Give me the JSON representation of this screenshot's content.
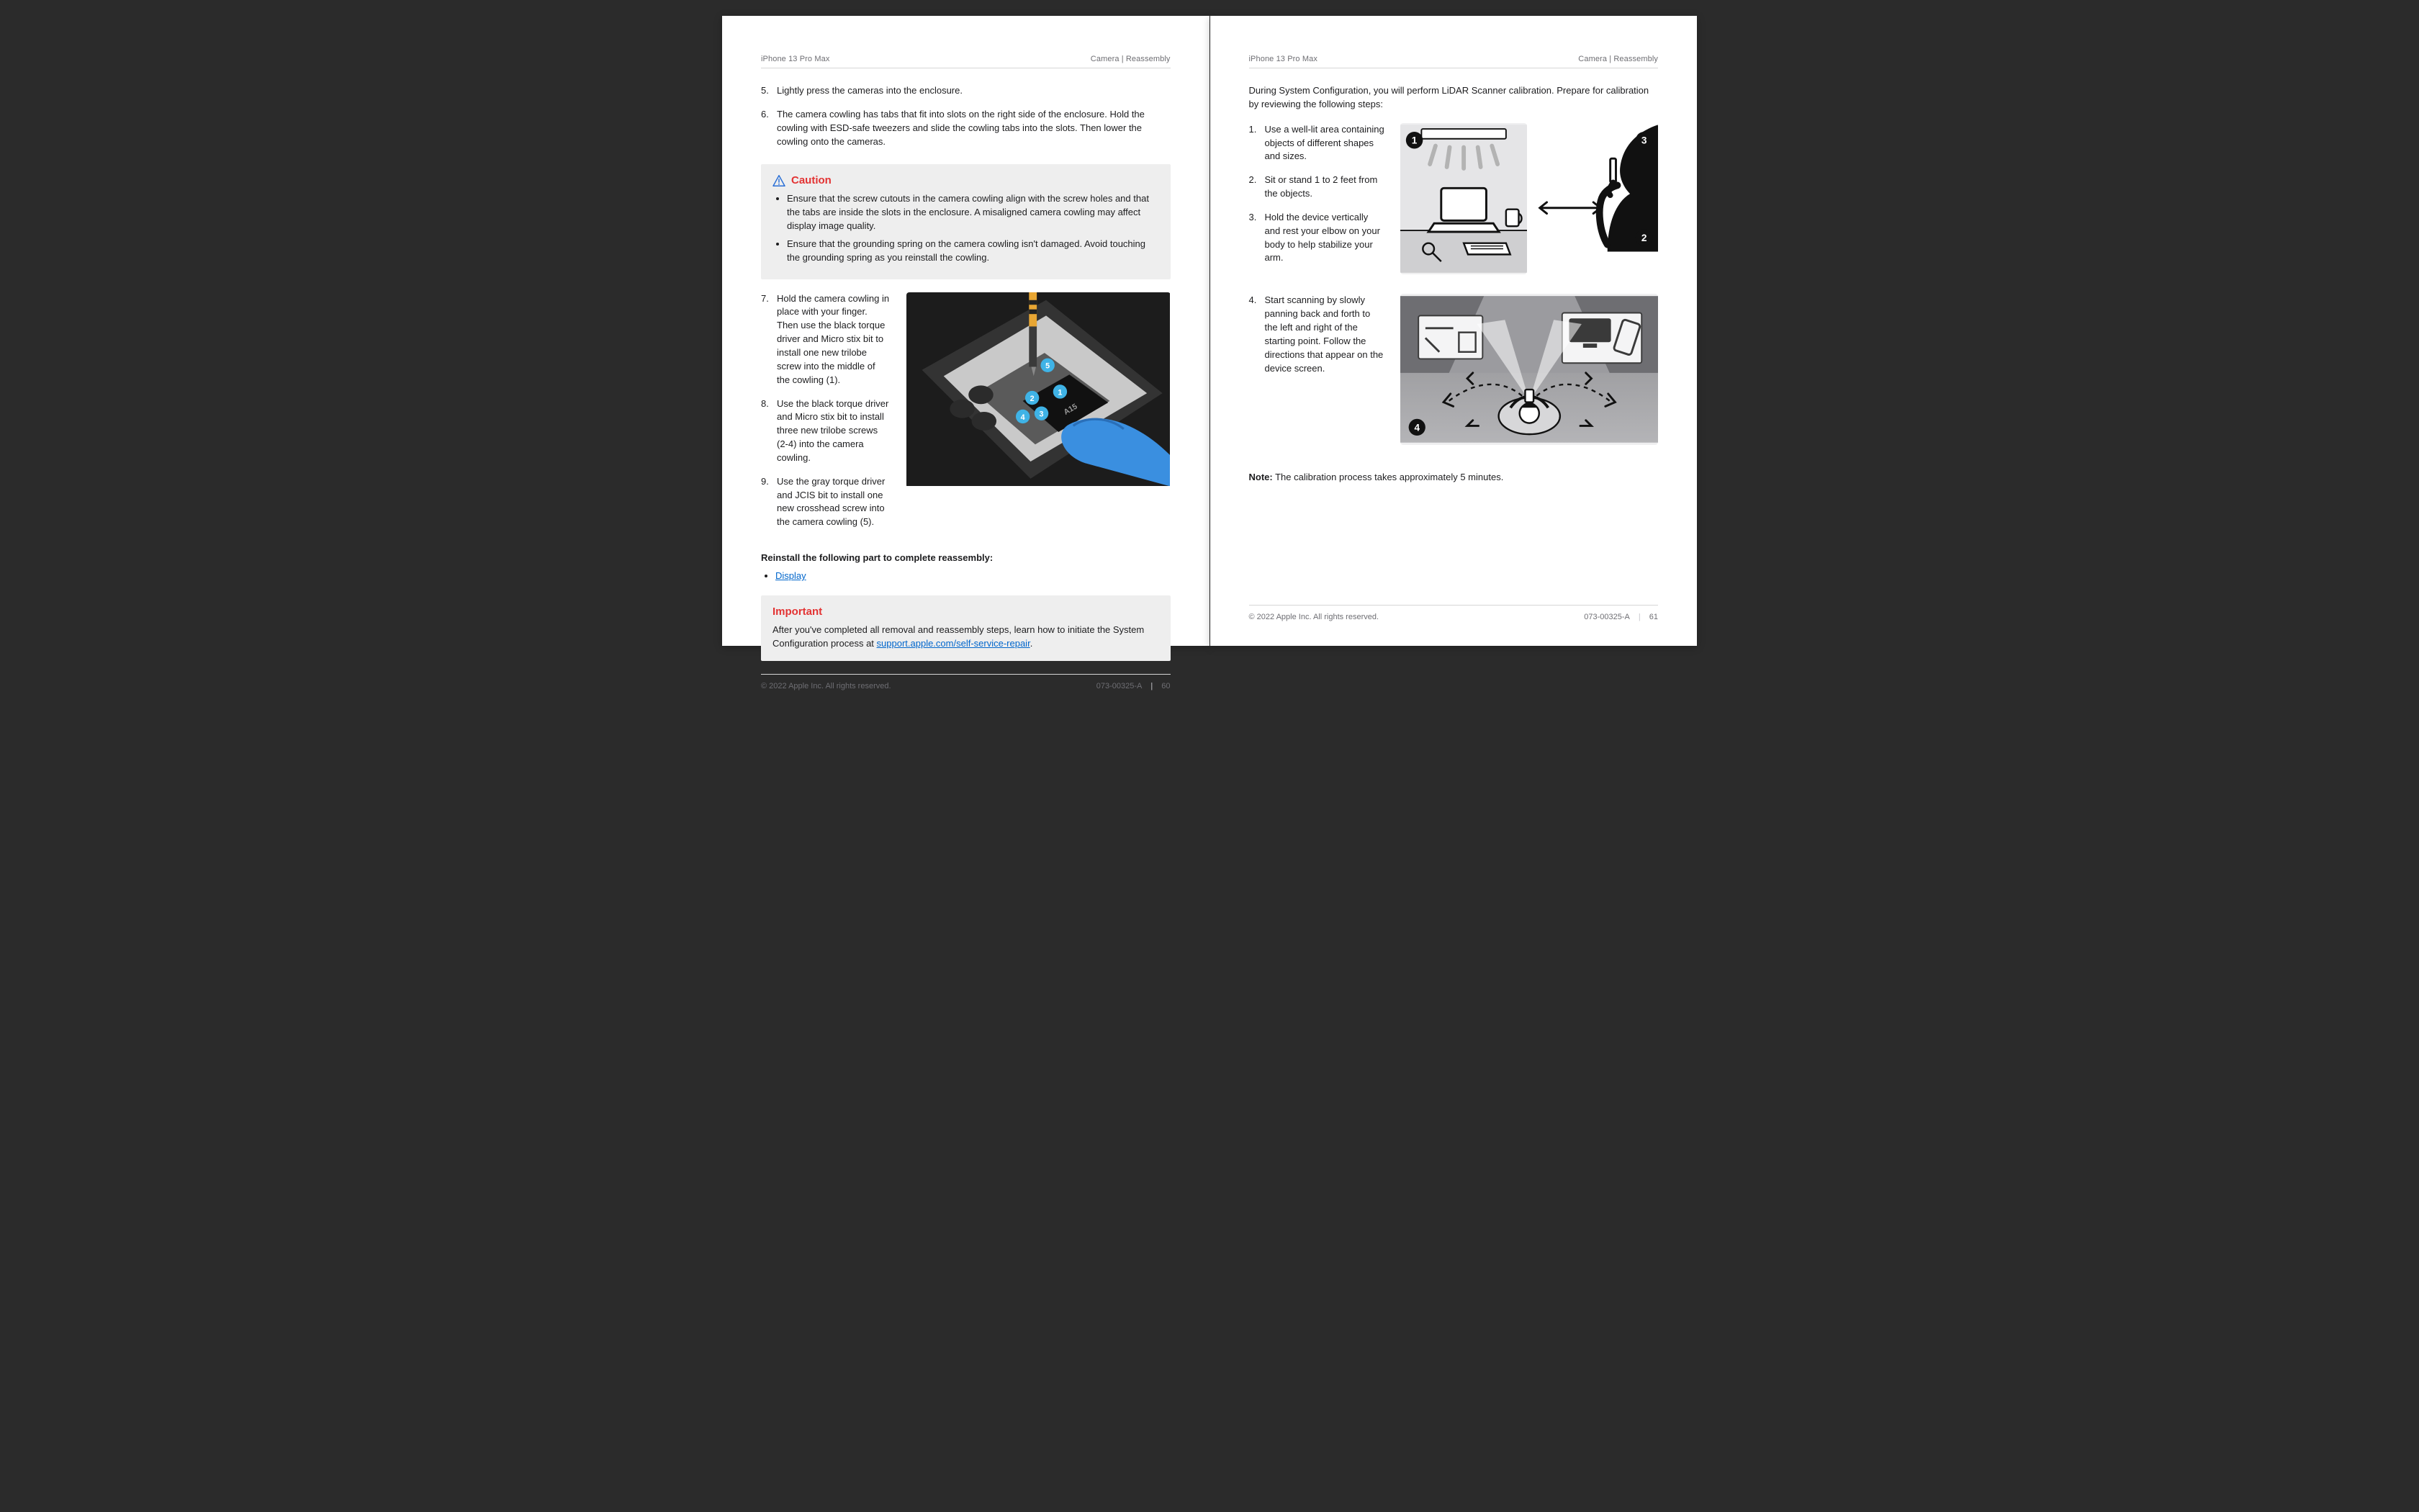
{
  "header": {
    "device": "iPhone 13 Pro Max",
    "section": "Camera | Reassembly"
  },
  "footer": {
    "copyright": "© 2022 Apple Inc. All rights reserved.",
    "doc_number": "073-00325-A",
    "page_left": "60",
    "page_right": "61"
  },
  "left_page": {
    "steps_a": [
      {
        "n": "5",
        "text": "Lightly press the cameras into the enclosure."
      },
      {
        "n": "6",
        "text": "The camera cowling has tabs that fit into slots on the right side of the enclosure. Hold the cowling with ESD-safe tweezers and slide the cowling tabs into the slots. Then lower the cowling onto the cameras."
      }
    ],
    "caution": {
      "title": "Caution",
      "items": [
        "Ensure that the screw cutouts in the camera cowling align with the screw holes and that the tabs are inside the slots in the enclosure. A misaligned camera cowling may affect display image quality.",
        "Ensure that the grounding spring on the camera cowling isn't damaged. Avoid touching the grounding spring as you reinstall the cowling."
      ]
    },
    "steps_b": [
      {
        "n": "7",
        "text": "Hold the camera cowling in place with your finger. Then use the black torque driver and Micro stix bit to install one new trilobe screw into the middle of the cowling (1)."
      },
      {
        "n": "8",
        "text": "Use the black torque driver and Micro stix bit to install three new trilobe screws (2-4) into the camera cowling."
      },
      {
        "n": "9",
        "text": "Use the gray torque driver and JCIS bit to install one new crosshead screw into the camera cowling (5)."
      }
    ],
    "subhead": "Reinstall the following part to complete reassembly:",
    "link_display": "Display",
    "important": {
      "title": "Important",
      "text_before": "After you've completed all removal and reassembly steps, learn how to initiate the System Configuration process at ",
      "link_text": "support.apple.com/self-service-repair",
      "text_after": "."
    },
    "photo_markers": [
      "1",
      "2",
      "3",
      "4",
      "5"
    ]
  },
  "right_page": {
    "intro": "During System Configuration, you will perform LiDAR Scanner calibration. Prepare for calibration by reviewing the following steps:",
    "steps_top": [
      {
        "n": "1",
        "text": "Use a well-lit area containing objects of different shapes and sizes."
      },
      {
        "n": "2",
        "text": "Sit or stand 1 to 2 feet from the objects."
      },
      {
        "n": "3",
        "text": "Hold the device vertically and rest your elbow on your body to help stabilize your arm."
      }
    ],
    "steps_mid": [
      {
        "n": "4",
        "text": "Start scanning by slowly panning back and forth to the left and right of the starting point. Follow the directions that appear on the device screen."
      }
    ],
    "fig_badges_top": [
      "1",
      "2",
      "3"
    ],
    "fig_badge_bottom": "4",
    "note": {
      "label": "Note:",
      "text": " The calibration process takes approximately 5 minutes."
    }
  }
}
